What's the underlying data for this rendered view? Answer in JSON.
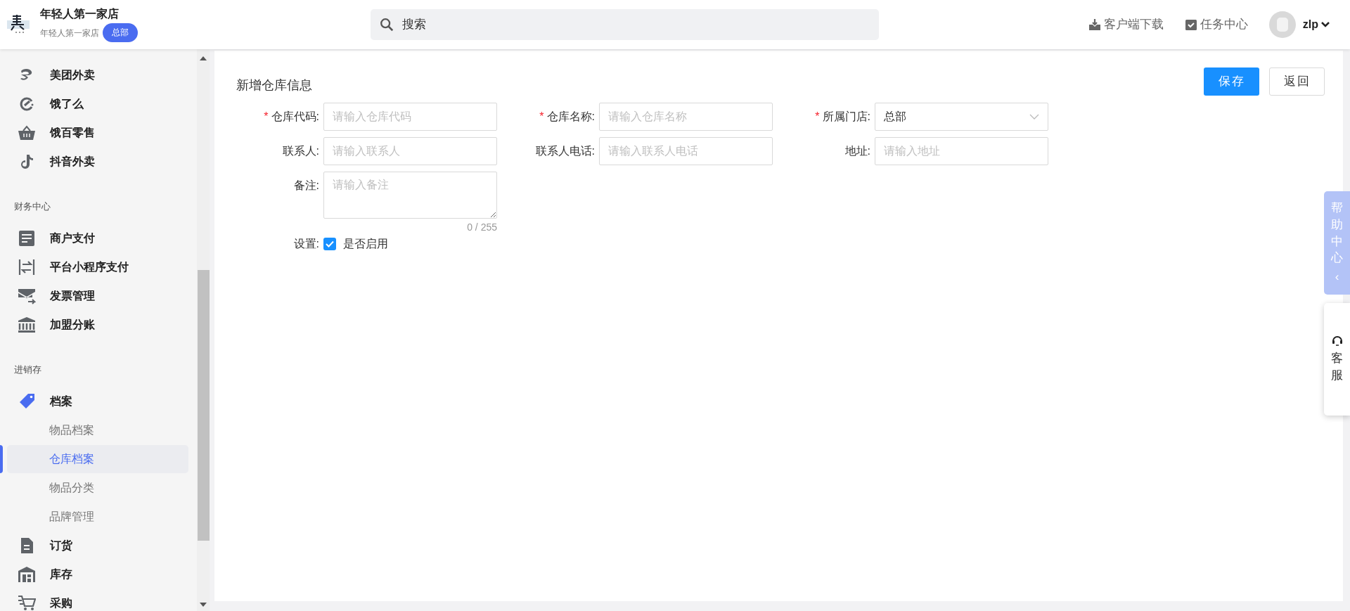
{
  "header": {
    "store_name": "年轻人第一家店",
    "store_sub": "年轻人第一家店",
    "badge": "总部",
    "search": {
      "placeholder": "搜索"
    },
    "actions": [
      {
        "label": "客户端下载"
      },
      {
        "label": "任务中心"
      }
    ],
    "user": "zlp"
  },
  "sidebar": {
    "groups": [
      {
        "items": [
          {
            "label": "美团外卖"
          },
          {
            "label": "饿了么"
          },
          {
            "label": "饿百零售"
          },
          {
            "label": "抖音外卖"
          }
        ]
      },
      {
        "title": "财务中心",
        "items": [
          {
            "label": "商户支付"
          },
          {
            "label": "平台小程序支付"
          },
          {
            "label": "发票管理"
          },
          {
            "label": "加盟分账"
          }
        ]
      },
      {
        "title": "进销存",
        "items": [
          {
            "label": "档案",
            "children": [
              {
                "label": "物品档案",
                "selected": false
              },
              {
                "label": "仓库档案",
                "selected": true
              },
              {
                "label": "物品分类",
                "selected": false
              },
              {
                "label": "品牌管理",
                "selected": false
              }
            ]
          },
          {
            "label": "订货"
          },
          {
            "label": "库存"
          },
          {
            "label": "采购"
          }
        ]
      }
    ]
  },
  "form": {
    "title": "新增仓库信息",
    "buttons": [
      {
        "label": "保存",
        "kind": "primary"
      },
      {
        "label": "返回",
        "kind": "default"
      }
    ],
    "rows": [
      [
        {
          "label": "仓库代码:",
          "required_mark": "*",
          "kind": "input",
          "placeholder": "请输入仓库代码"
        },
        {
          "label": "仓库名称:",
          "required_mark": "*",
          "kind": "input",
          "placeholder": "请输入仓库名称"
        },
        {
          "label": "所属门店:",
          "required_mark": "*",
          "kind": "select",
          "value": "总部"
        }
      ],
      [
        {
          "label": "联系人:",
          "kind": "input",
          "placeholder": "请输入联系人"
        },
        {
          "label": "联系人电话:",
          "kind": "input",
          "placeholder": "请输入联系人电话"
        },
        {
          "label": "地址:",
          "kind": "input",
          "placeholder": "请输入地址"
        }
      ],
      [
        {
          "label": "备注:",
          "kind": "textarea",
          "placeholder": "请输入备注",
          "counter": "0 / 255"
        }
      ]
    ],
    "setting": {
      "label": "设置:",
      "option": "是否启用",
      "checked": true
    }
  },
  "float": {
    "help": "帮助中心",
    "help_arrow": "‹",
    "service": "客服"
  }
}
